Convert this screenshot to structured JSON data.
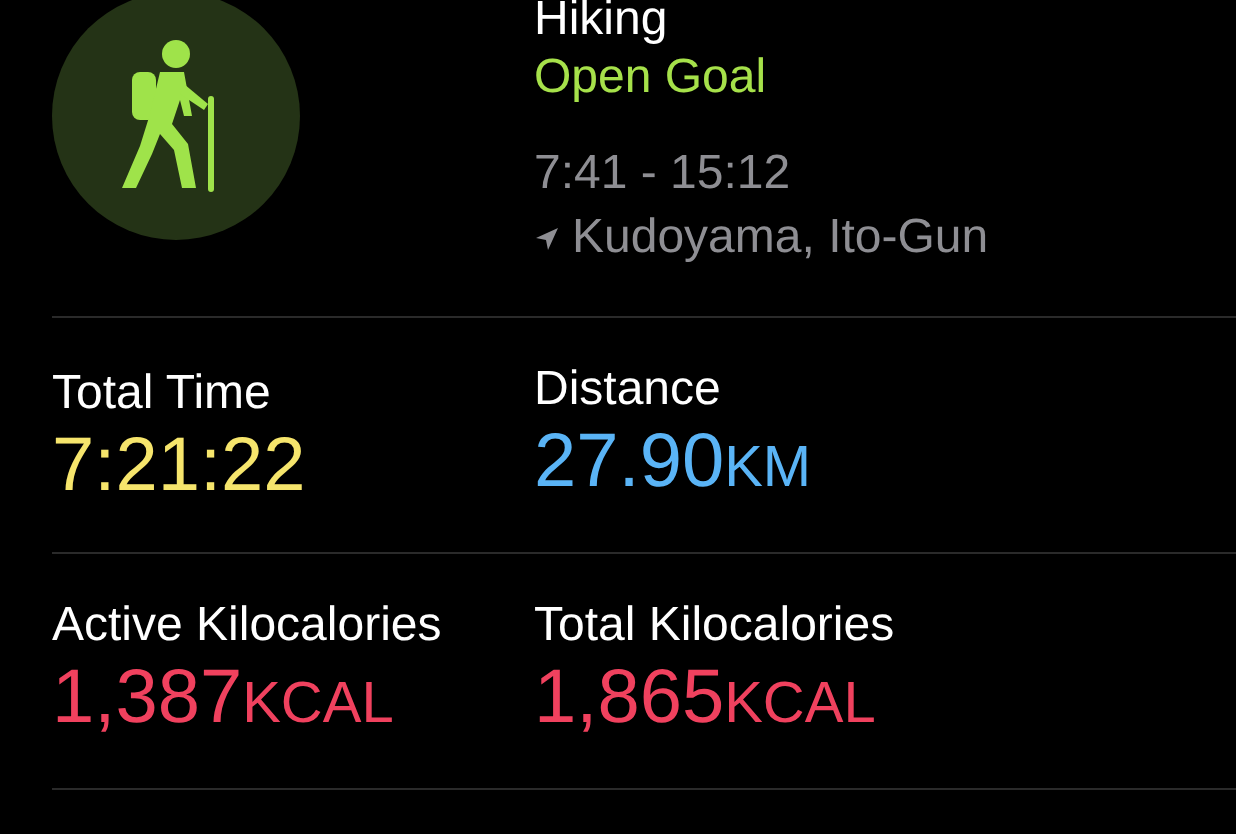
{
  "workout": {
    "title": "Hiking",
    "goal": "Open Goal",
    "time_range": "7:41 - 15:12",
    "location": "Kudoyama, Ito-Gun"
  },
  "stats": [
    {
      "label": "Total Time",
      "value": "7:21:22",
      "color": "#f6e56c"
    },
    {
      "label": "Distance",
      "value": "27.90",
      "unit": "KM",
      "color": "#5ab4f6"
    },
    {
      "label": "Active Kilocalories",
      "value": "1,387",
      "unit": "KCAL",
      "color": "#f0415e"
    },
    {
      "label": "Total Kilocalories",
      "value": "1,865",
      "unit": "KCAL",
      "color": "#f0415e"
    }
  ]
}
